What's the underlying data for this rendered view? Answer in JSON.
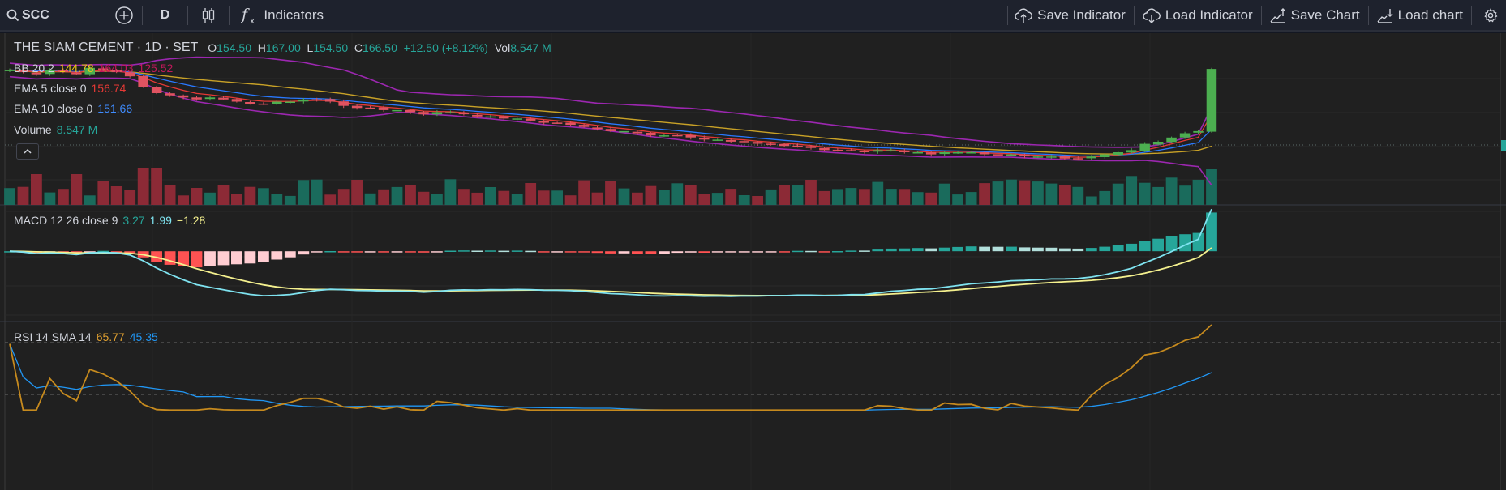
{
  "toolbar": {
    "symbol": "SCC",
    "interval": "D",
    "indicators_label": "Indicators",
    "save_indicator_label": "Save Indicator",
    "load_indicator_label": "Load Indicator",
    "save_chart_label": "Save Chart",
    "load_chart_label": "Load chart"
  },
  "legend": {
    "title": "THE SIAM CEMENT · 1D · SET",
    "ohlc": {
      "o_label": "O",
      "o": "154.50",
      "h_label": "H",
      "h": "167.00",
      "l_label": "L",
      "l": "154.50",
      "c_label": "C",
      "c": "166.50",
      "change": "+12.50 (+8.12%)",
      "vol_label": "Vol",
      "vol": "8.547 M"
    },
    "bb": {
      "name": "BB 20 2",
      "basis": "144.78",
      "upper": "164.03",
      "lower": "125.52"
    },
    "ema5": {
      "name": "EMA 5 close 0",
      "value": "156.74"
    },
    "ema10": {
      "name": "EMA 10 close 0",
      "value": "151.66"
    },
    "volume": {
      "name": "Volume",
      "value": "8.547 M"
    },
    "macd": {
      "name": "MACD 12 26 close 9",
      "hist": "3.27",
      "macd": "1.99",
      "signal": "−1.28"
    },
    "rsi": {
      "name": "RSI 14 SMA 14",
      "rsi": "65.77",
      "sma": "45.35"
    }
  },
  "colors": {
    "up": "#26a69a",
    "down": "#ef5350",
    "candle_up": "#4caf50",
    "candle_down": "#e05361",
    "bb_band": "#9c27b0",
    "bb_basis": "#c9a227",
    "ema5": "#e53935",
    "ema10": "#2979ff",
    "vol_up": "#1a6b5c",
    "vol_down": "#8c2a36",
    "macd_line": "#7fe3f0",
    "signal_line": "#f4f08e",
    "rsi_line": "#c68a1e",
    "rsi_sma": "#2196f3"
  },
  "chart_data": {
    "type": "candlestick",
    "symbol": "THE SIAM CEMENT",
    "interval": "1D",
    "exchange": "SET",
    "close": [
      166,
      165,
      164,
      166,
      165,
      164,
      167,
      166,
      165,
      163,
      158,
      155,
      154,
      153,
      152,
      153,
      152,
      151,
      150,
      150,
      151,
      151,
      152,
      152,
      151,
      149,
      148,
      148,
      147,
      147,
      146,
      145,
      146,
      146,
      145,
      144,
      144,
      143,
      143,
      142,
      141,
      141,
      140,
      139,
      138,
      137,
      137,
      136,
      135,
      135,
      135,
      134,
      133,
      133,
      132,
      132,
      131,
      131,
      130,
      130,
      129,
      128,
      128,
      128,
      127,
      128,
      128,
      127,
      127,
      126,
      127,
      127,
      127,
      126,
      126,
      126,
      125,
      125,
      125,
      124,
      124,
      125,
      126,
      127,
      128,
      131,
      132,
      134,
      136,
      137,
      166.5
    ],
    "volume_label": "Vol",
    "last_volume": "8.547 M",
    "macd": {
      "hist": 3.27,
      "macd": 1.99,
      "signal": -1.28
    },
    "rsi": {
      "value": 65.77,
      "sma": 45.35
    }
  }
}
